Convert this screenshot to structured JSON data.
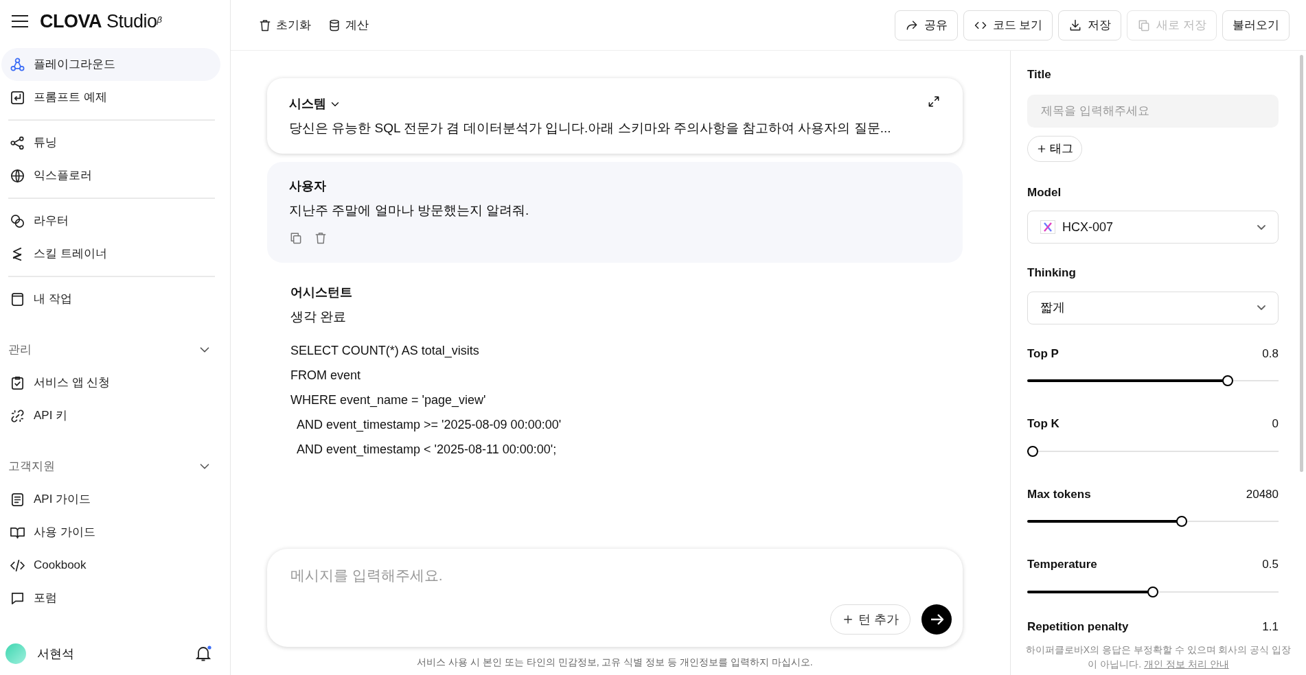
{
  "sidebar": {
    "brand": "**CLOVA** Studio$^{β}$",
    "groups": [
      {
        "items": [
          {
            "label": "플레이그라운드",
            "selected": true
          },
          {
            "label": "프롬프트 예제",
            "selected": false
          }
        ]
      },
      {
        "items": [
          {
            "label": "튜닝",
            "selected": false
          },
          {
            "label": "익스플로러",
            "selected": false
          }
        ]
      },
      {
        "items": [
          {
            "label": "라우터",
            "selected": false
          },
          {
            "label": "스킬 트레이너",
            "selected": false
          }
        ]
      },
      {
        "items": [
          {
            "label": "내 작업",
            "selected": false
          }
        ]
      }
    ],
    "sections": [
      {
        "title": "관리",
        "expanded": true,
        "items": [
          {
            "label": "서비스 앱 신청",
            "selected": false
          },
          {
            "label": "API 키",
            "selected": false
          }
        ]
      },
      {
        "title": "고객지원",
        "expanded": true,
        "items": [
          {
            "label": "API 가이드",
            "selected": false
          },
          {
            "label": "사용 가이드",
            "selected": false
          },
          {
            "label": "Cookbook",
            "selected": false
          },
          {
            "label": "포럼",
            "selected": false
          }
        ]
      }
    ],
    "user": {
      "name": "서현석",
      "notification": true
    }
  },
  "toolbar": {
    "left": [
      {
        "label": "초기화"
      },
      {
        "label": "계산"
      }
    ],
    "buttons": [
      {
        "label": "공유",
        "disabled": false
      },
      {
        "label": "코드 보기",
        "disabled": false
      },
      {
        "label": "저장",
        "disabled": false
      },
      {
        "label": "새로 저장",
        "disabled": true
      },
      {
        "label": "불러오기",
        "disabled": false
      }
    ]
  },
  "chat": {
    "system": {
      "role": "시스템",
      "text": "당신은 유능한 SQL 전문가 겸 데이터분석가 입니다.아래 스키마와 주의사항을 참고하여 사용자의 질문..."
    },
    "messages": [
      {
        "kind": "user",
        "role": "사용자",
        "text": "지난주 주말에 얼마나 방문했는지 알려줘."
      },
      {
        "kind": "assistant",
        "role": "어시스턴트",
        "status": "생각 완료",
        "lines": [
          "SELECT COUNT(*) AS total_visits",
          "FROM event",
          "WHERE event_name = 'page_view'",
          "  AND event_timestamp >= '2025-08-09 00:00:00'",
          "  AND event_timestamp < '2025-08-11 00:00:00';"
        ]
      }
    ],
    "input": {
      "placeholder": "메시지를 입력해주세요.",
      "add_turn": "턴 추가"
    },
    "disclaimer": "서비스 사용 시 본인 또는 타인의 민감정보, 고유 식별 정보 등 개인정보를 입력하지 마십시오."
  },
  "settings": {
    "title": {
      "label": "Title",
      "placeholder": "제목을 입력해주세요"
    },
    "tag_button": "태그",
    "model": {
      "label": "Model",
      "value": "HCX-007"
    },
    "thinking": {
      "label": "Thinking",
      "value": "짧게"
    },
    "sliders": [
      {
        "label": "Top P",
        "reading": "0.8",
        "level": 0.81
      },
      {
        "label": "Top K",
        "reading": "0",
        "level": 0
      },
      {
        "label": "Max tokens",
        "reading": "20480",
        "level": 0.62
      },
      {
        "label": "Temperature",
        "reading": "0.5",
        "level": 0.5
      }
    ],
    "partial_row": {
      "label": "Repetition penalty",
      "reading": "1.1"
    },
    "notice": {
      "text": "하이퍼클로바X의 응답은 부정확할 수 있으며 회사의 공식 입장이 아닙니다.",
      "link": "개인 정보 처리 안내"
    }
  }
}
